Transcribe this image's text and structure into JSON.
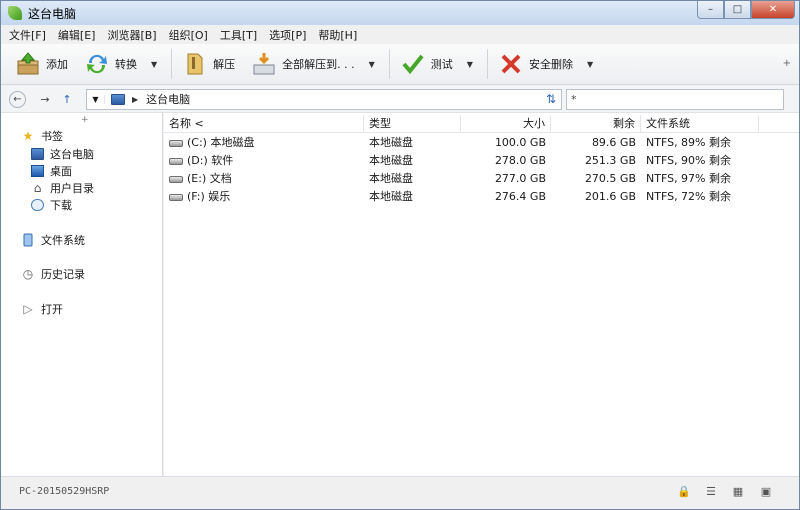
{
  "window": {
    "title": "这台电脑",
    "minimize_glyph": "–",
    "maximize_glyph": "□",
    "close_glyph": "✕"
  },
  "menu": [
    "文件[F]",
    "编辑[E]",
    "浏览器[B]",
    "组织[O]",
    "工具[T]",
    "选项[P]",
    "帮助[H]"
  ],
  "toolbar": {
    "add": "添加",
    "convert": "转换",
    "extract": "解压",
    "extract_all": "全部解压到. . .",
    "test": "测试",
    "secure_delete": "安全删除",
    "more": "+"
  },
  "address": {
    "path": "这台电脑",
    "search_value": "*"
  },
  "sidebar": {
    "collapse": "+",
    "bookmarks": "书签",
    "bookmark_items": [
      "这台电脑",
      "桌面",
      "用户目录",
      "下载"
    ],
    "filesystem": "文件系统",
    "history": "历史记录",
    "open": "打开"
  },
  "columns": {
    "name": "名称 <",
    "type": "类型",
    "size": "大小",
    "free": "剩余",
    "fs": "文件系统"
  },
  "drives": [
    {
      "name": "(C:) 本地磁盘",
      "type": "本地磁盘",
      "size": "100.0 GB",
      "free": "89.6 GB",
      "fs": "NTFS, 89% 剩余"
    },
    {
      "name": "(D:) 软件",
      "type": "本地磁盘",
      "size": "278.0 GB",
      "free": "251.3 GB",
      "fs": "NTFS, 90% 剩余"
    },
    {
      "name": "(E:) 文档",
      "type": "本地磁盘",
      "size": "277.0 GB",
      "free": "270.5 GB",
      "fs": "NTFS, 97% 剩余"
    },
    {
      "name": "(F:) 娱乐",
      "type": "本地磁盘",
      "size": "276.4 GB",
      "free": "201.6 GB",
      "fs": "NTFS, 72% 剩余"
    }
  ],
  "status": {
    "computer_name": "PC-20150529HSRP"
  },
  "colors": {
    "accent": "#3167b5",
    "title_bar": "#c4d7ee",
    "close_button": "#c7432b"
  }
}
